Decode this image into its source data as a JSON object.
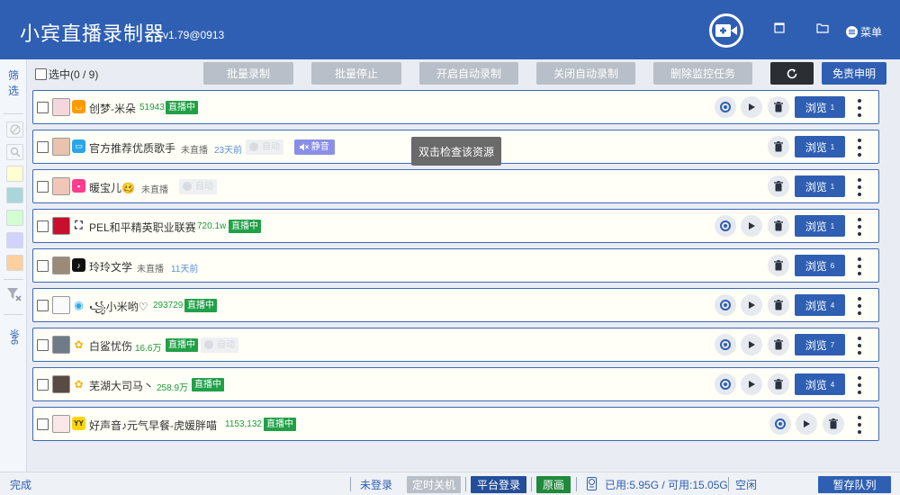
{
  "app": {
    "title": "小宾直播录制器",
    "version": "v1.79@0913",
    "menu_label": "菜单"
  },
  "sidebar": {
    "title": "筛选",
    "count_label": "9条"
  },
  "toolbar": {
    "select_all_label": "选中(0 / 9)",
    "batch_record": "批量录制",
    "batch_stop": "批量停止",
    "enable_auto_record": "开启自动录制",
    "disable_auto_record": "关闭自动录制",
    "delete_monitor_tasks": "删除监控任务",
    "disclaimer": "免责申明"
  },
  "tooltip": "双击检查该资源",
  "rows": [
    {
      "name": "创梦-米朵",
      "meta": "51943",
      "live": "直播中",
      "platform_icon": "mouth-orange-icon",
      "platform_color": "#ff9b00",
      "browse": "浏览",
      "browse_count": "1"
    },
    {
      "name": "官方推荐优质歌手",
      "status": "未直播",
      "time_ago": "23天前",
      "faint": "自动",
      "mute": "静音",
      "platform_icon": "bilibili-tv-icon",
      "platform_color": "#29a6e8",
      "browse": "浏览",
      "browse_count": "1"
    },
    {
      "name": "暖宝儿🥴",
      "status": "未直播",
      "faint": "自动",
      "platform_icon": "pink-square-icon",
      "platform_color": "#ff3c8e",
      "browse": "浏览",
      "browse_count": "1"
    },
    {
      "name": "PEL和平精英职业联赛",
      "meta": "720.1w",
      "live": "直播中",
      "platform_icon": "camera-icon",
      "platform_color": "#222222",
      "browse": "浏览",
      "browse_count": "1"
    },
    {
      "name": "玲玲文学",
      "status": "未直播",
      "time_ago": "11天前",
      "platform_icon": "tiktok-icon",
      "platform_color": "#111111",
      "browse": "浏览",
      "browse_count": "6"
    },
    {
      "name": "꧁小米哟♡",
      "meta": "293729",
      "live": "直播中",
      "platform_icon": "eye-blue-icon",
      "platform_color": "#2fa6e6",
      "browse": "浏览",
      "browse_count": "4"
    },
    {
      "name": "白鲨忧伤",
      "meta": "16.6万",
      "live": "直播中",
      "faint": "自动",
      "platform_icon": "bee-icon",
      "platform_color": "#f6b400",
      "browse": "浏览",
      "browse_count": "7"
    },
    {
      "name": "芜湖大司马丶",
      "meta": "258.9万",
      "live": "直播中",
      "platform_icon": "bee-icon",
      "platform_color": "#f6b400",
      "browse": "浏览",
      "browse_count": "4"
    },
    {
      "name": "好声音♪元气早餐-虎媛胖喵",
      "meta": "1153,132",
      "live": "直播中",
      "platform_icon": "yy-icon",
      "platform_color": "#ffd500",
      "browse": "",
      "browse_count": ""
    }
  ],
  "status_bar": {
    "state": "完成",
    "login": "未登录",
    "timed_shutdown": "定时关机",
    "platform_login": "平台登录",
    "original": "原画",
    "disk": "已用:5.95G / 可用:15.05G",
    "idle": "空闲",
    "save_queue": "暂存队列"
  }
}
